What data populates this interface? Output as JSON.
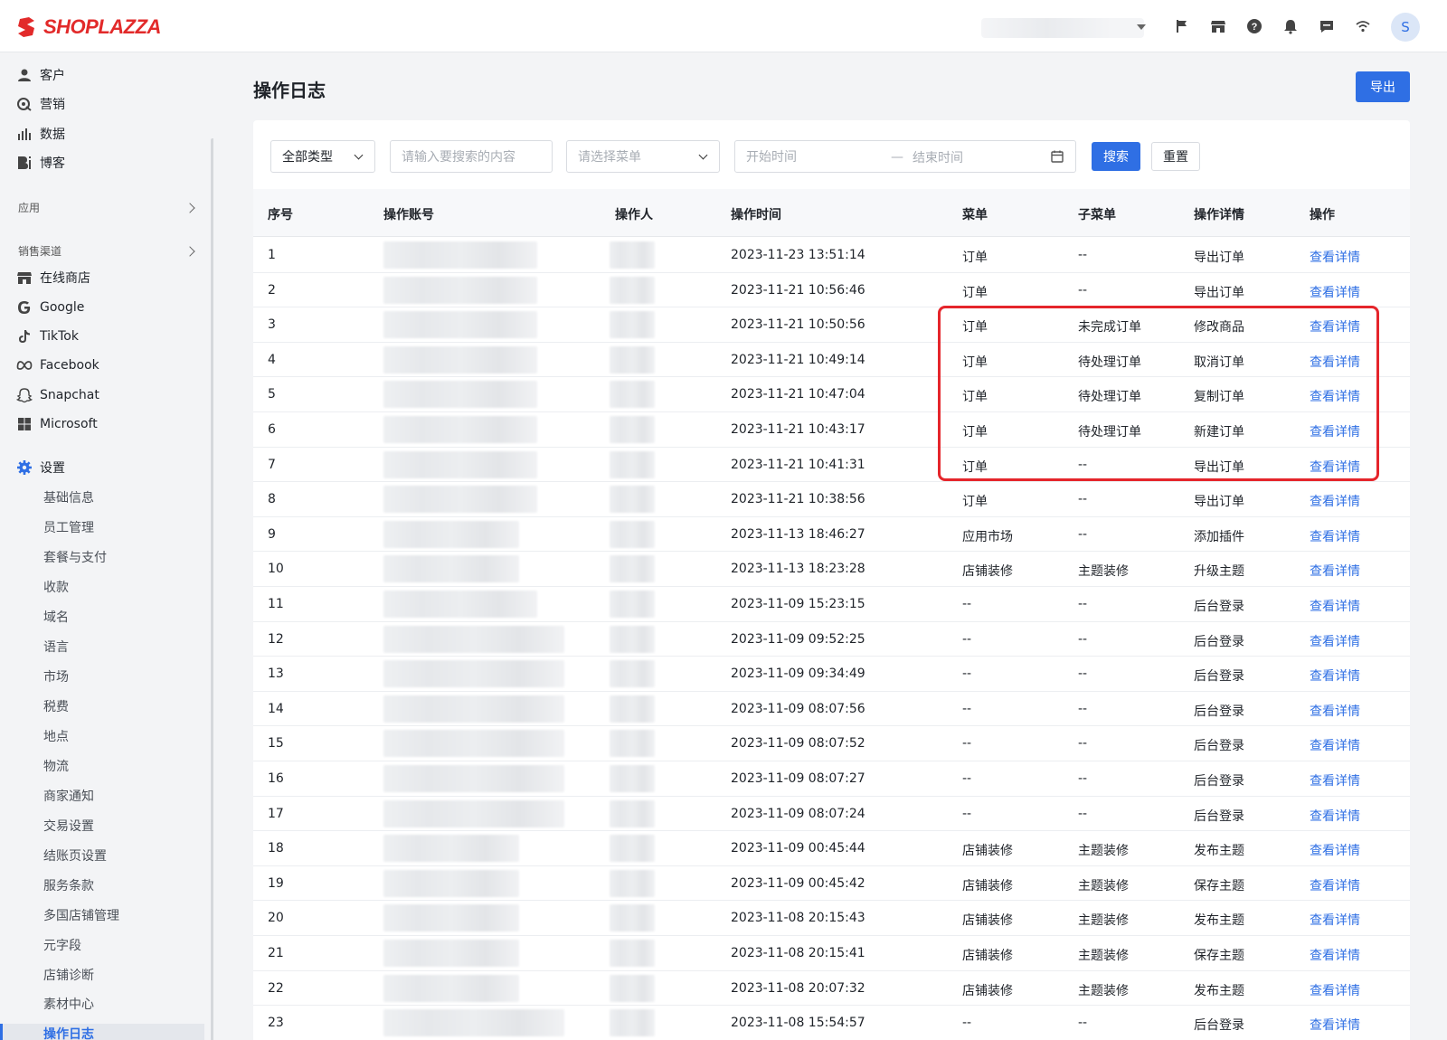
{
  "brand": {
    "name": "SHOPLAZZA",
    "color": "#e22a2a"
  },
  "header": {
    "avatar_initial": "S",
    "icons": [
      "flag-icon",
      "store-icon",
      "help-icon",
      "bell-icon",
      "message-icon",
      "wifi-icon"
    ]
  },
  "sidebar": {
    "top_items": [
      {
        "label": "客户",
        "icon": "user-icon"
      },
      {
        "label": "营销",
        "icon": "marketing-icon"
      },
      {
        "label": "数据",
        "icon": "chart-icon"
      },
      {
        "label": "博客",
        "icon": "blog-icon"
      }
    ],
    "apps_section": "应用",
    "channels_section": "销售渠道",
    "channels": [
      {
        "label": "在线商店",
        "icon": "store-icon"
      },
      {
        "label": "Google",
        "icon": "google-icon"
      },
      {
        "label": "TikTok",
        "icon": "tiktok-icon"
      },
      {
        "label": "Facebook",
        "icon": "meta-icon"
      },
      {
        "label": "Snapchat",
        "icon": "snapchat-icon"
      },
      {
        "label": "Microsoft",
        "icon": "microsoft-icon"
      }
    ],
    "settings_label": "设置",
    "settings_items": [
      "基础信息",
      "员工管理",
      "套餐与支付",
      "收款",
      "域名",
      "语言",
      "市场",
      "税费",
      "地点",
      "物流",
      "商家通知",
      "交易设置",
      "结账页设置",
      "服务条款",
      "多国店铺管理",
      "元字段",
      "店铺诊断",
      "素材中心",
      "操作日志"
    ],
    "active_item": "操作日志"
  },
  "page": {
    "title": "操作日志",
    "export_label": "导出"
  },
  "filters": {
    "type_select": "全部类型",
    "search_placeholder": "请输入要搜索的内容",
    "menu_placeholder": "请选择菜单",
    "start_placeholder": "开始时间",
    "date_separator": "—",
    "end_placeholder": "结束时间",
    "search_label": "搜索",
    "reset_label": "重置"
  },
  "table": {
    "columns": [
      "序号",
      "操作账号",
      "操作人",
      "操作时间",
      "菜单",
      "子菜单",
      "操作详情",
      "操作"
    ],
    "action_label": "查看详情",
    "rows": [
      {
        "no": "1",
        "time": "2023-11-23 13:51:14",
        "menu": "订单",
        "submenu": "--",
        "detail": "导出订单"
      },
      {
        "no": "2",
        "time": "2023-11-21 10:56:46",
        "menu": "订单",
        "submenu": "--",
        "detail": "导出订单"
      },
      {
        "no": "3",
        "time": "2023-11-21 10:50:56",
        "menu": "订单",
        "submenu": "未完成订单",
        "detail": "修改商品"
      },
      {
        "no": "4",
        "time": "2023-11-21 10:49:14",
        "menu": "订单",
        "submenu": "待处理订单",
        "detail": "取消订单"
      },
      {
        "no": "5",
        "time": "2023-11-21 10:47:04",
        "menu": "订单",
        "submenu": "待处理订单",
        "detail": "复制订单"
      },
      {
        "no": "6",
        "time": "2023-11-21 10:43:17",
        "menu": "订单",
        "submenu": "待处理订单",
        "detail": "新建订单"
      },
      {
        "no": "7",
        "time": "2023-11-21 10:41:31",
        "menu": "订单",
        "submenu": "--",
        "detail": "导出订单"
      },
      {
        "no": "8",
        "time": "2023-11-21 10:38:56",
        "menu": "订单",
        "submenu": "--",
        "detail": "导出订单"
      },
      {
        "no": "9",
        "time": "2023-11-13 18:46:27",
        "menu": "应用市场",
        "submenu": "--",
        "detail": "添加插件"
      },
      {
        "no": "10",
        "time": "2023-11-13 18:23:28",
        "menu": "店铺装修",
        "submenu": "主题装修",
        "detail": "升级主题"
      },
      {
        "no": "11",
        "time": "2023-11-09 15:23:15",
        "menu": "--",
        "submenu": "--",
        "detail": "后台登录"
      },
      {
        "no": "12",
        "time": "2023-11-09 09:52:25",
        "menu": "--",
        "submenu": "--",
        "detail": "后台登录"
      },
      {
        "no": "13",
        "time": "2023-11-09 09:34:49",
        "menu": "--",
        "submenu": "--",
        "detail": "后台登录"
      },
      {
        "no": "14",
        "time": "2023-11-09 08:07:56",
        "menu": "--",
        "submenu": "--",
        "detail": "后台登录"
      },
      {
        "no": "15",
        "time": "2023-11-09 08:07:52",
        "menu": "--",
        "submenu": "--",
        "detail": "后台登录"
      },
      {
        "no": "16",
        "time": "2023-11-09 08:07:27",
        "menu": "--",
        "submenu": "--",
        "detail": "后台登录"
      },
      {
        "no": "17",
        "time": "2023-11-09 08:07:24",
        "menu": "--",
        "submenu": "--",
        "detail": "后台登录"
      },
      {
        "no": "18",
        "time": "2023-11-09 00:45:44",
        "menu": "店铺装修",
        "submenu": "主题装修",
        "detail": "发布主题"
      },
      {
        "no": "19",
        "time": "2023-11-09 00:45:42",
        "menu": "店铺装修",
        "submenu": "主题装修",
        "detail": "保存主题"
      },
      {
        "no": "20",
        "time": "2023-11-08 20:15:43",
        "menu": "店铺装修",
        "submenu": "主题装修",
        "detail": "发布主题"
      },
      {
        "no": "21",
        "time": "2023-11-08 20:15:41",
        "menu": "店铺装修",
        "submenu": "主题装修",
        "detail": "保存主题"
      },
      {
        "no": "22",
        "time": "2023-11-08 20:07:32",
        "menu": "店铺装修",
        "submenu": "主题装修",
        "detail": "发布主题"
      },
      {
        "no": "23",
        "time": "2023-11-08 15:54:57",
        "menu": "--",
        "submenu": "--",
        "detail": "后台登录"
      }
    ]
  },
  "colors": {
    "primary": "#2f6fe4",
    "highlight": "#e5252b"
  }
}
